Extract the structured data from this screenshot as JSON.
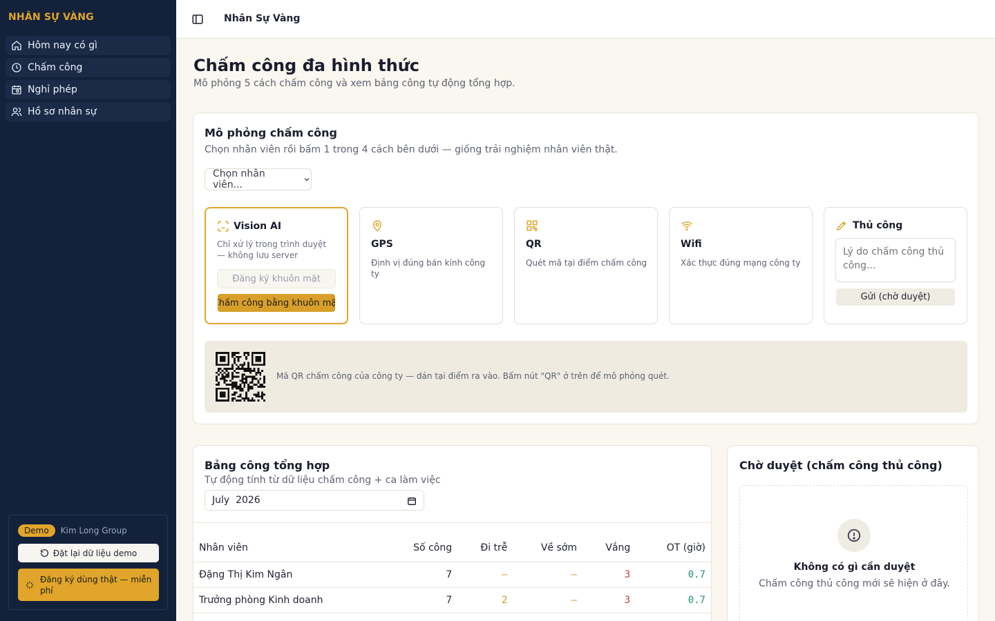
{
  "sidebar": {
    "brand": "NHÂN SỰ VÀNG",
    "items": [
      {
        "label": "Hôm nay có gì",
        "icon": "home-icon"
      },
      {
        "label": "Chấm công",
        "icon": "clock-icon"
      },
      {
        "label": "Nghỉ phép",
        "icon": "calendar-icon"
      },
      {
        "label": "Hồ sơ nhân sự",
        "icon": "users-icon"
      }
    ],
    "footer": {
      "badge": "Demo",
      "org": "Kim Long Group",
      "reset_label": "Đặt lại dữ liệu demo",
      "signup_label": "Đăng ký dùng thật — miễn phí"
    }
  },
  "topbar": {
    "title": "Nhân Sự Vàng"
  },
  "page": {
    "title": "Chấm công đa hình thức",
    "subtitle": "Mô phỏng 5 cách chấm công và xem bảng công tự động tổng hợp."
  },
  "simulator": {
    "title": "Mô phỏng chấm công",
    "subtitle": "Chọn nhân viên rồi bấm 1 trong 4 cách bên dưới — giống trải nghiệm nhân viên thật.",
    "employee_select": "Chọn nhân viên...",
    "vision": {
      "title": "Vision AI",
      "desc": "Chỉ xử lý trong trình duyệt — không lưu server",
      "register_label": "Đăng ký khuôn mặt",
      "checkin_label": "Chấm công bằng khuôn mặt"
    },
    "gps": {
      "title": "GPS",
      "desc": "Định vị đúng bán kính công ty"
    },
    "qr": {
      "title": "QR",
      "desc": "Quét mã tại điểm chấm công"
    },
    "wifi": {
      "title": "Wifi",
      "desc": "Xác thực đúng mạng công ty"
    },
    "manual": {
      "title": "Thủ công",
      "placeholder": "Lý do chấm công thủ công...",
      "submit_label": "Gửi (chờ duyệt)"
    },
    "qr_banner_text": "Mã QR chấm công của công ty — dán tại điểm ra vào. Bấm nút \"QR\" ở trên để mô phỏng quét."
  },
  "accent_color": "#e0a52a",
  "summary": {
    "title": "Bảng công tổng hợp",
    "subtitle": "Tự động tính từ dữ liệu chấm công + ca làm việc",
    "month": "July  2026",
    "columns": [
      "Nhân viên",
      "Số công",
      "Đi trễ",
      "Về sớm",
      "Vắng",
      "OT (giờ)"
    ],
    "rows": [
      [
        "Đặng Thị Kim Ngân",
        "7",
        "—",
        "—",
        "3",
        "0.7"
      ],
      [
        "Trưởng phòng Kinh doanh",
        "7",
        "2",
        "—",
        "3",
        "0.7"
      ]
    ]
  },
  "pending": {
    "title": "Chờ duyệt (chấm công thủ công)",
    "empty_title": "Không có gì cần duyệt",
    "empty_sub": "Chấm công thủ công mới sẽ hiện ở đây."
  }
}
